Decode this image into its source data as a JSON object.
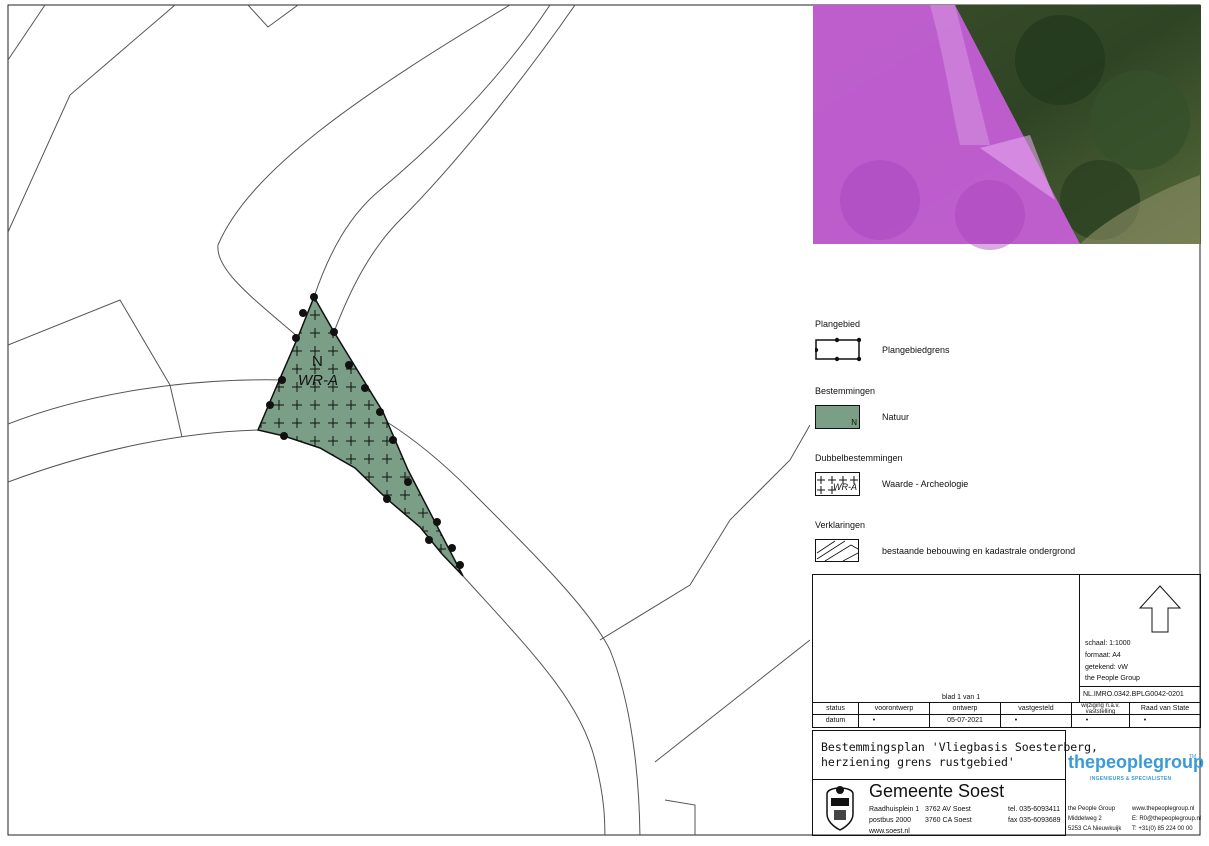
{
  "map": {
    "zone_codes": [
      "N",
      "WR-A"
    ],
    "colors": {
      "natuur_fill": "#7a9e86",
      "photo_overlay": "#c55fd6",
      "line": "#555555"
    }
  },
  "legend": {
    "sections": [
      {
        "title": "Plangebied",
        "items": [
          {
            "label": "Plangebiedgrens",
            "symbol": "plan-boundary"
          }
        ]
      },
      {
        "title": "Bestemmingen",
        "items": [
          {
            "label": "Natuur",
            "symbol": "natuur",
            "code": "N"
          }
        ]
      },
      {
        "title": "Dubbelbestemmingen",
        "items": [
          {
            "label": "Waarde - Archeologie",
            "symbol": "archeologie",
            "code": "WR-A"
          }
        ]
      },
      {
        "title": "Verklaringen",
        "items": [
          {
            "label": "bestaande bebouwing en kadastrale ondergrond",
            "symbol": "kadastrale"
          }
        ]
      }
    ]
  },
  "titleblock": {
    "sheet": "blad 1 van 1",
    "scale": "schaal: 1:1000",
    "format": "formaat: A4",
    "drawn": "getekend: vW",
    "company": "the People Group",
    "plan_id": "NL.IMRO.0342.BPLG0042-0201",
    "status_headers": [
      "status",
      "voorontwerp",
      "ontwerp",
      "vastgesteld",
      "wijziging n.a.v. vaststelling",
      "Raad van State"
    ],
    "status_row": [
      "datum",
      "•",
      "05-07-2021",
      "•",
      "•",
      "•"
    ],
    "plan_title_line1": "Bestemmingsplan 'Vliegbasis Soesterberg,",
    "plan_title_line2": "herziening grens rustgebied'",
    "brand_text": "thepeoplegroup",
    "brand_tm": "TM",
    "brand_sub": "INGENIEURS & SPECIALISTEN",
    "gemeente": "Gemeente Soest",
    "address": {
      "col1": [
        "Raadhuisplein 1",
        "postbus 2000",
        "www.soest.nl"
      ],
      "col2": [
        "3762 AV Soest",
        "3760 CA Soest"
      ],
      "col3": [
        "tel. 035-6093411",
        "fax 035-6093689"
      ]
    },
    "tpg_contact": {
      "col1": [
        "the People Group",
        "Middelweg 2",
        "5253 CA Nieuwkuijk"
      ],
      "col2": [
        "www.thepeoplegroup.nl",
        "E: R0@thepeoplegroup.nl",
        "T: +31(0) 85 224 00 00"
      ]
    }
  }
}
